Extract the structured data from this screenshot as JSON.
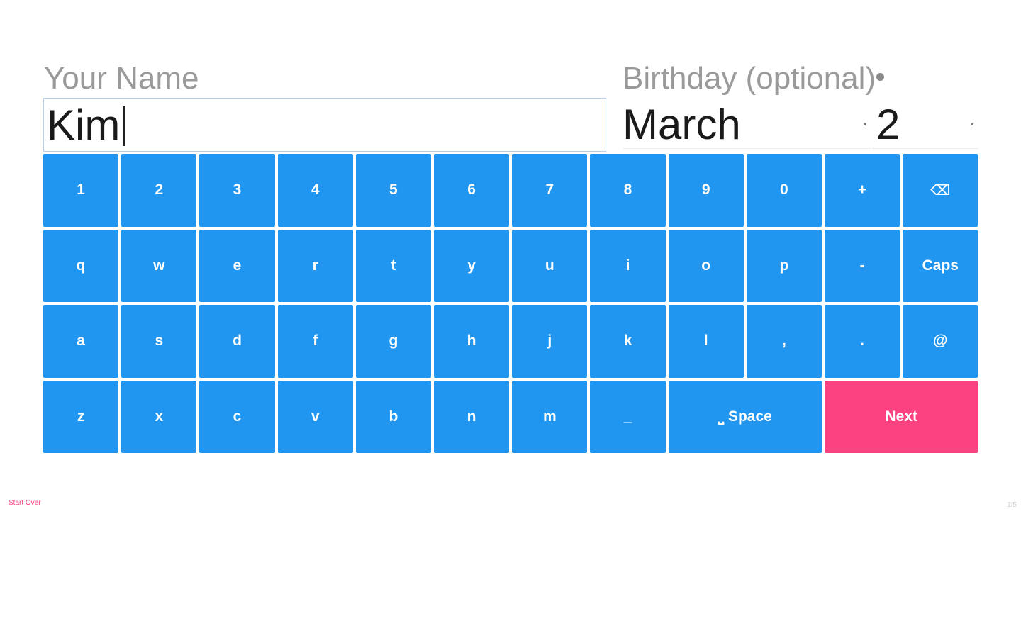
{
  "form": {
    "name_label": "Your Name",
    "name_value": "Kim",
    "birthday_label": "Birthday (optional)",
    "birthday_month": "March",
    "birthday_day": "2"
  },
  "keyboard": {
    "rows": [
      [
        "1",
        "2",
        "3",
        "4",
        "5",
        "6",
        "7",
        "8",
        "9",
        "0",
        "+",
        "⌫"
      ],
      [
        "q",
        "w",
        "e",
        "r",
        "t",
        "y",
        "u",
        "i",
        "o",
        "p",
        "-",
        "Caps"
      ],
      [
        "a",
        "s",
        "d",
        "f",
        "g",
        "h",
        "j",
        "k",
        "l",
        ",",
        ".",
        "@"
      ],
      [
        "z",
        "x",
        "c",
        "v",
        "b",
        "n",
        "m",
        "_",
        "⎵ Space",
        "Next"
      ]
    ],
    "backspace_icon": "backspace-icon",
    "next_color": "#fc4280",
    "key_color": "#2196f0"
  },
  "footer": {
    "start_over": "Start Over",
    "page_indicator": "1/5"
  },
  "colors": {
    "key_blue": "#2196f0",
    "accent_pink": "#fc4280",
    "label_gray": "#9a9a9a"
  }
}
